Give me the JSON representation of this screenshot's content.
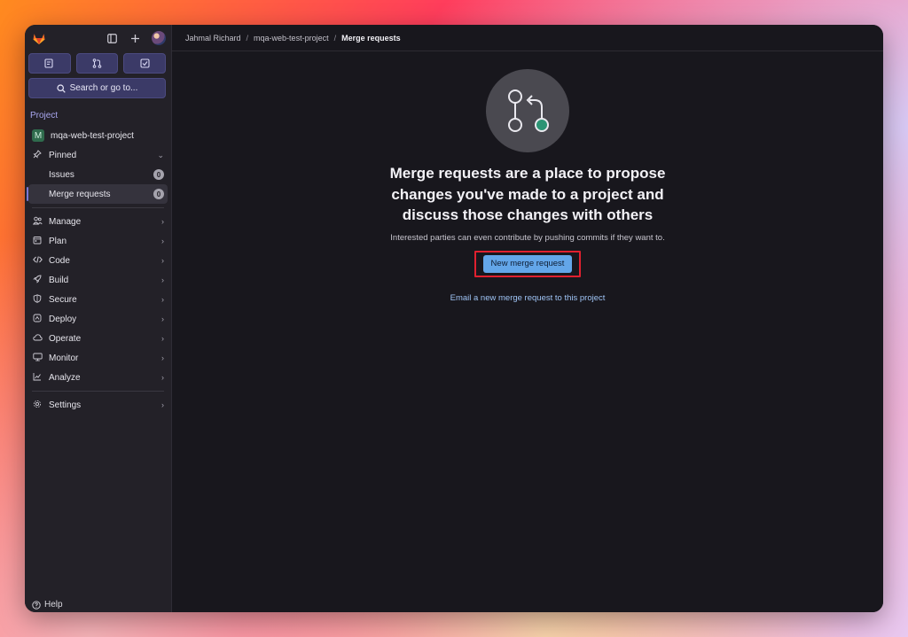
{
  "sidebar": {
    "search_label": "Search or go to...",
    "section_label": "Project",
    "project_name": "mqa-web-test-project",
    "project_initial": "M",
    "pinned_label": "Pinned",
    "pinned_items": [
      {
        "label": "Issues",
        "count": "0"
      },
      {
        "label": "Merge requests",
        "count": "0"
      }
    ],
    "nav_items": [
      {
        "label": "Manage",
        "icon": "users-icon"
      },
      {
        "label": "Plan",
        "icon": "calendar-icon"
      },
      {
        "label": "Code",
        "icon": "code-icon"
      },
      {
        "label": "Build",
        "icon": "rocket-icon"
      },
      {
        "label": "Secure",
        "icon": "shield-icon"
      },
      {
        "label": "Deploy",
        "icon": "deploy-icon"
      },
      {
        "label": "Operate",
        "icon": "cloud-icon"
      },
      {
        "label": "Monitor",
        "icon": "monitor-icon"
      },
      {
        "label": "Analyze",
        "icon": "chart-icon"
      }
    ],
    "settings_label": "Settings",
    "help_label": "Help"
  },
  "breadcrumb": {
    "items": [
      "Jahmal Richard",
      "mqa-web-test-project"
    ],
    "current": "Merge requests"
  },
  "empty_state": {
    "title": "Merge requests are a place to propose changes you've made to a project and discuss those changes with others",
    "description": "Interested parties can even contribute by pushing commits if they want to.",
    "button_label": "New merge request",
    "email_link": "Email a new merge request to this project"
  },
  "colors": {
    "accent": "#63a6e9",
    "highlight": "#e0202f",
    "sidebar_bg": "#232128",
    "main_bg": "#18171d"
  }
}
